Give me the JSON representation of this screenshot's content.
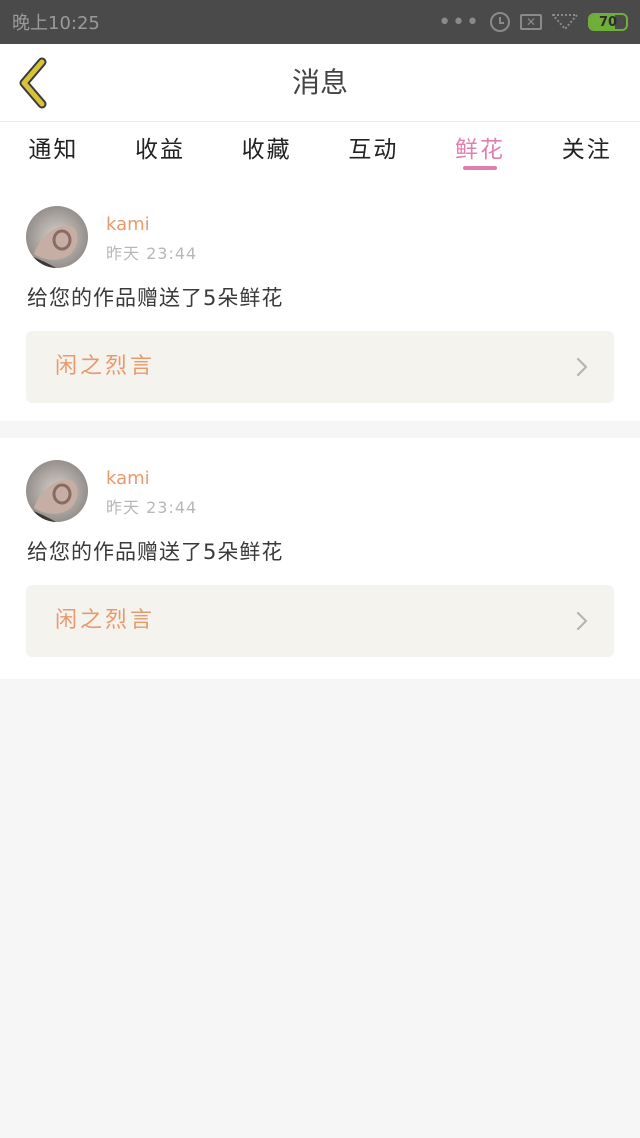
{
  "status_bar": {
    "time": "晚上10:25",
    "dots": "•••",
    "nosim_glyph": "✕",
    "battery_level": "70",
    "battery_fraction": 0.7,
    "battery_color": "#6fae3a"
  },
  "header": {
    "title": "消息",
    "back_icon": "chevron-left-icon",
    "back_icon_color": "#d9c23a"
  },
  "tabs": [
    {
      "label": "通知",
      "active": false
    },
    {
      "label": "收益",
      "active": false
    },
    {
      "label": "收藏",
      "active": false
    },
    {
      "label": "互动",
      "active": false
    },
    {
      "label": "鲜花",
      "active": true
    },
    {
      "label": "关注",
      "active": false
    }
  ],
  "accent_color": "#e17fb0",
  "messages": [
    {
      "user": "kami",
      "time": "昨天 23:44",
      "text": "给您的作品赠送了5朵鲜花",
      "work_title": "闲之烈言"
    },
    {
      "user": "kami",
      "time": "昨天 23:44",
      "text": "给您的作品赠送了5朵鲜花",
      "work_title": "闲之烈言"
    }
  ]
}
